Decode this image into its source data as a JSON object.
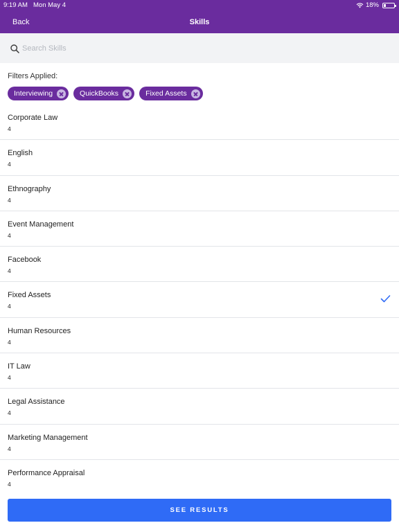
{
  "status_bar": {
    "time": "9:19 AM",
    "date": "Mon May 4",
    "battery": "18%",
    "battery_level": 0.18
  },
  "nav": {
    "back_label": "Back",
    "title": "Skills"
  },
  "search": {
    "placeholder": "Search Skills",
    "value": ""
  },
  "filters": {
    "label": "Filters Applied:",
    "chips": [
      {
        "label": "Interviewing"
      },
      {
        "label": "QuickBooks"
      },
      {
        "label": "Fixed Assets"
      }
    ]
  },
  "skills": [
    {
      "name": "Corporate Law",
      "count": "4",
      "selected": false
    },
    {
      "name": "English",
      "count": "4",
      "selected": false
    },
    {
      "name": "Ethnography",
      "count": "4",
      "selected": false
    },
    {
      "name": "Event Management",
      "count": "4",
      "selected": false
    },
    {
      "name": "Facebook",
      "count": "4",
      "selected": false
    },
    {
      "name": "Fixed Assets",
      "count": "4",
      "selected": true
    },
    {
      "name": "Human Resources",
      "count": "4",
      "selected": false
    },
    {
      "name": "IT Law",
      "count": "4",
      "selected": false
    },
    {
      "name": "Legal Assistance",
      "count": "4",
      "selected": false
    },
    {
      "name": "Marketing Management",
      "count": "4",
      "selected": false
    },
    {
      "name": "Performance Appraisal",
      "count": "4",
      "selected": false
    }
  ],
  "footer": {
    "button_label": "SEE RESULTS"
  },
  "colors": {
    "header": "#6a2c9e",
    "chip": "#6a2c9e",
    "button": "#2f6bf6",
    "check": "#2f6bf6"
  },
  "icons": {
    "search": "search-icon",
    "wifi": "wifi-icon",
    "battery": "battery-icon",
    "check": "check-icon",
    "chip_remove": "close-circle-icon"
  }
}
